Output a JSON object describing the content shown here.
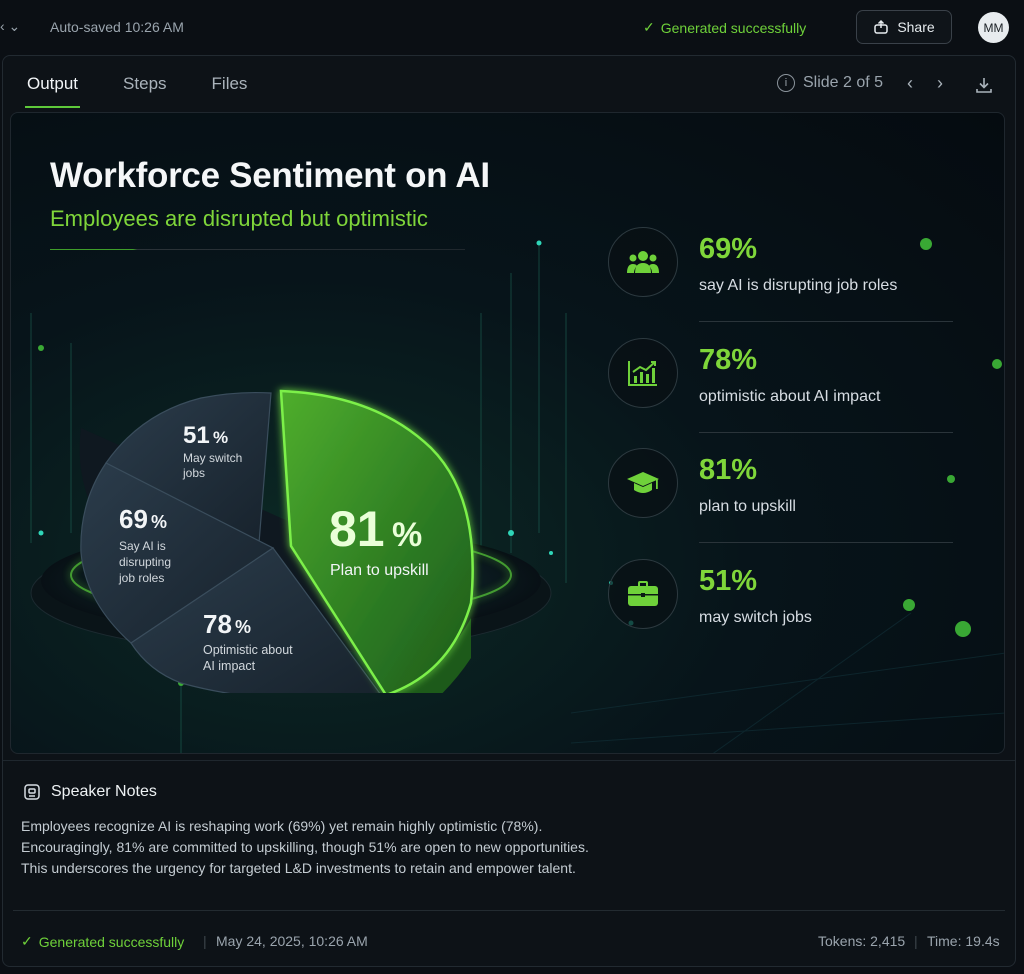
{
  "topbar": {
    "back_glyph": "‹ ⌄",
    "autosave": "Auto-saved 10:26 AM",
    "status": "Generated successfully",
    "share_label": "Share",
    "avatar_initials": "MM"
  },
  "tabs": [
    {
      "label": "Output",
      "active": true
    },
    {
      "label": "Steps",
      "active": false
    },
    {
      "label": "Files",
      "active": false
    }
  ],
  "slide_nav": {
    "counter": "Slide 2 of 5"
  },
  "slide": {
    "title": "Workforce Sentiment on AI",
    "subtitle": "Employees are disrupted but optimistic",
    "pie": {
      "segments": [
        {
          "value": "81",
          "unit": "%",
          "label": "Plan to upskill",
          "highlight": true
        },
        {
          "value": "78",
          "unit": "%",
          "label": "Optimistic about AI impact",
          "highlight": false
        },
        {
          "value": "69",
          "unit": "%",
          "label": "Say AI is disrupting job roles",
          "highlight": false
        },
        {
          "value": "51",
          "unit": "%",
          "label": "May switch jobs",
          "highlight": false
        }
      ],
      "labels_lines": {
        "s51": [
          "May switch",
          "jobs"
        ],
        "s69": [
          "Say AI is",
          "disrupting",
          "job roles"
        ],
        "s78": [
          "Optimistic about",
          "AI impact"
        ],
        "s81": [
          "Plan to upskill"
        ]
      }
    },
    "stats": [
      {
        "value": "69%",
        "label": "say AI is disrupting job roles",
        "icon": "people-icon"
      },
      {
        "value": "78%",
        "label": "optimistic about AI impact",
        "icon": "chart-icon"
      },
      {
        "value": "81%",
        "label": "plan to upskill",
        "icon": "graduation-cap-icon"
      },
      {
        "value": "51%",
        "label": "may switch jobs",
        "icon": "briefcase-icon"
      }
    ]
  },
  "notes": {
    "heading": "Speaker Notes",
    "lines": [
      "Employees recognize AI is reshaping work (69%) yet remain highly optimistic (78%).",
      "Encouragingly, 81% are committed to upskilling, though 51% are open to new opportunities.",
      "This underscores the urgency for targeted L&D investments to retain and empower talent."
    ]
  },
  "footer": {
    "status": "Generated successfully",
    "date": "May 24, 2025, 10:26 AM",
    "tokens": "Tokens: 2,415",
    "time": "Time: 19.4s"
  },
  "colors": {
    "accent": "#7fd63a",
    "background": "#0b0f14"
  }
}
